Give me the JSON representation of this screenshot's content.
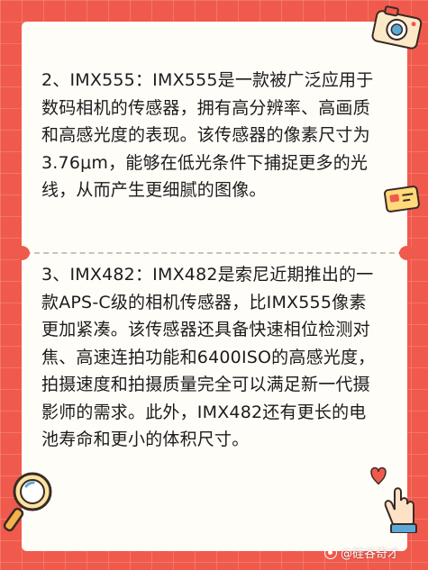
{
  "paragraphs": [
    {
      "text": "2、IMX555：IMX555是一款被广泛应用于数码相机的传感器，拥有高分辨率、高画质和高感光度的表现。该传感器的像素尺寸为3.76μm，能够在低光条件下捕捉更多的光线，从而产生更细腻的图像。"
    },
    {
      "text": "3、IMX482：IMX482是索尼近期推出的一款APS-C级的相机传感器，比IMX555像素更加紧凑。该传感器还具备快速相位检测对焦、高速连拍功能和6400ISO的高感光度，拍摄速度和拍摄质量完全可以满足新一代摄影师的需求。此外，IMX482还有更长的电池寿命和更小的体积尺寸。"
    }
  ],
  "watermark": "@硅谷奇才",
  "icons": {
    "camera": "camera-icon",
    "card": "id-card-icon",
    "magnifier": "magnifier-icon",
    "hand": "hand-heart-icon"
  },
  "colors": {
    "background": "#f05a4c",
    "card": "#fffdf8",
    "text": "#1c1c1c",
    "divider": "#c9c2b8"
  }
}
